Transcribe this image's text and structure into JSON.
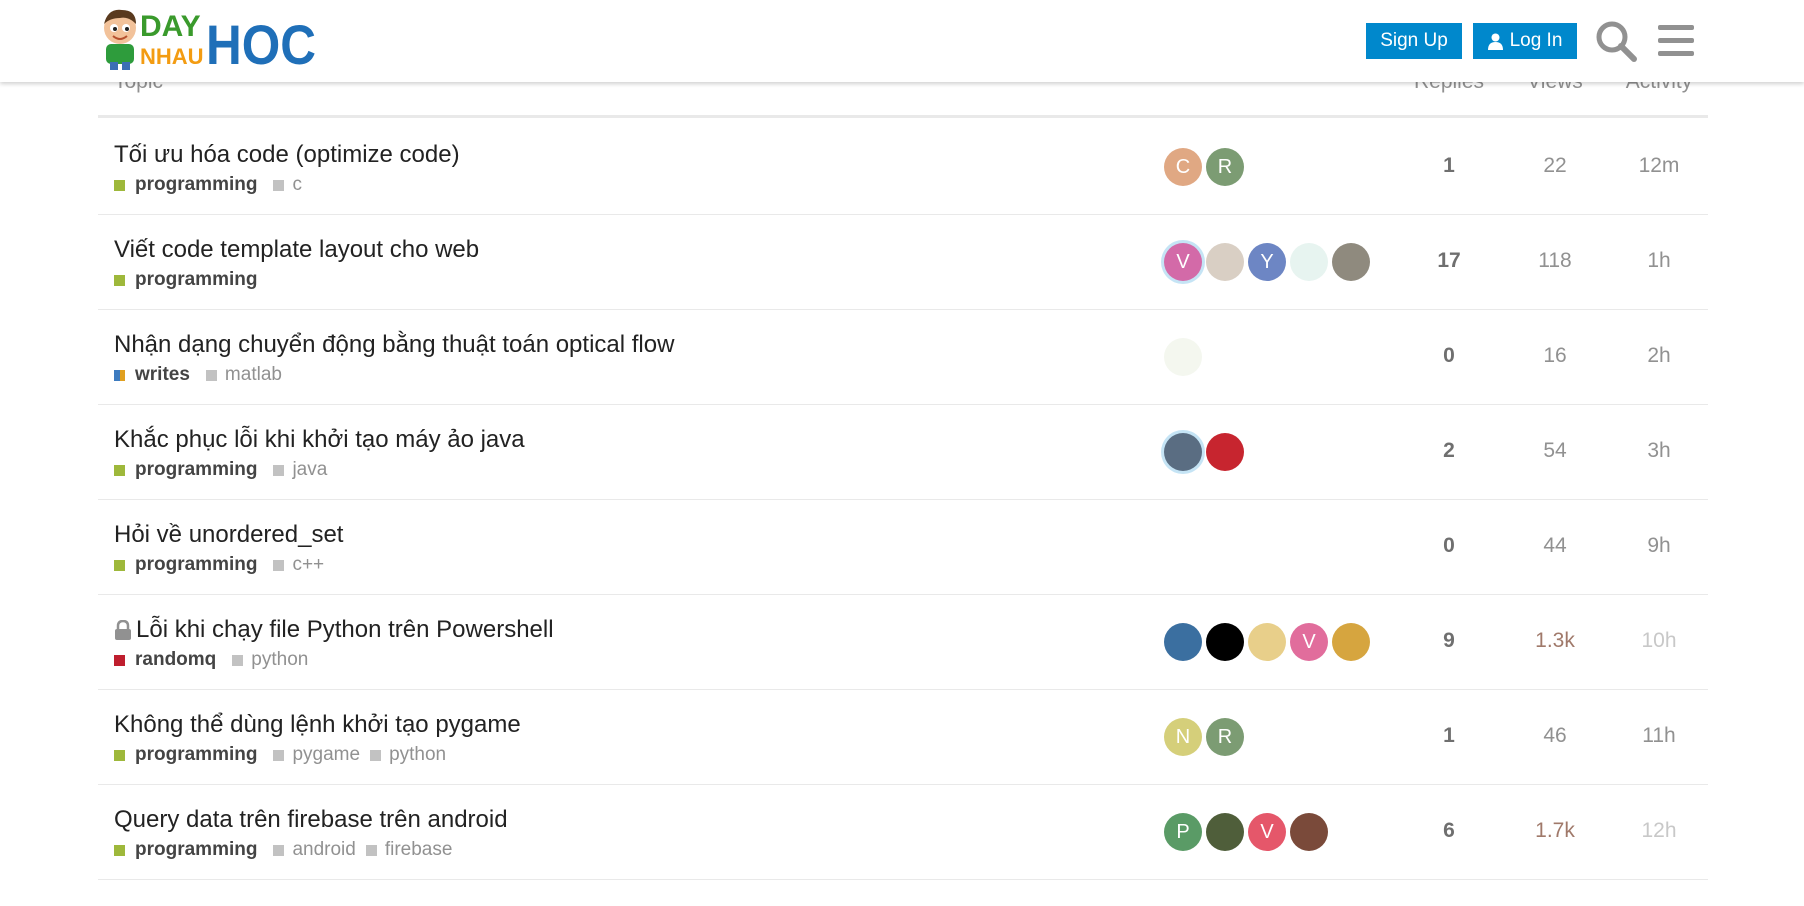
{
  "header": {
    "logo_text": "DAY NHAU HOC",
    "signup_label": "Sign Up",
    "login_label": "Log In",
    "brand_color": "#0088cc"
  },
  "table_head": {
    "topic": "Topic",
    "replies": "Replies",
    "views": "Views",
    "activity": "Activity"
  },
  "topics": [
    {
      "title": "Tối ưu hóa code (optimize code)",
      "category": "programming",
      "category_color": "#9eb83b",
      "tags": [
        "c"
      ],
      "posters": [
        {
          "letter": "C",
          "color": "#e0a883"
        },
        {
          "letter": "R",
          "color": "#7c9c73"
        }
      ],
      "replies": "1",
      "views": "22",
      "activity": "12m"
    },
    {
      "title": "Viết code template layout cho web",
      "category": "programming",
      "category_color": "#9eb83b",
      "tags": [],
      "posters": [
        {
          "letter": "V",
          "color": "#d36aa8"
        },
        {
          "letter": "",
          "color": "#d9cfc4"
        },
        {
          "letter": "Y",
          "color": "#6d86c4"
        },
        {
          "letter": "",
          "color": "#e7f4f0"
        },
        {
          "letter": "",
          "color": "#8f8a7e"
        }
      ],
      "replies": "17",
      "views": "118",
      "activity": "1h"
    },
    {
      "title": "Nhận dạng chuyển động bằng thuật toán optical flow",
      "category": "writes",
      "category_color": "#3d7bbf",
      "category_color2": "#e0a020",
      "tags": [
        "matlab"
      ],
      "posters": [
        {
          "letter": "",
          "color": "#f4f7ef"
        }
      ],
      "replies": "0",
      "views": "16",
      "activity": "2h"
    },
    {
      "title": "Khắc phục lỗi khi khởi tạo máy ảo java",
      "category": "programming",
      "category_color": "#9eb83b",
      "tags": [
        "java"
      ],
      "posters": [
        {
          "letter": "",
          "color": "#5a6d82"
        },
        {
          "letter": "",
          "color": "#c7252f"
        }
      ],
      "replies": "2",
      "views": "54",
      "activity": "3h"
    },
    {
      "title": "Hỏi về unordered_set",
      "category": "programming",
      "category_color": "#9eb83b",
      "tags": [
        "c++"
      ],
      "posters": [],
      "replies": "0",
      "views": "44",
      "activity": "9h"
    },
    {
      "title": "Lỗi khi chạy file Python trên Powershell",
      "closed": true,
      "category": "randomq",
      "category_color": "#bf1e2e",
      "tags": [
        "python"
      ],
      "posters": [
        {
          "letter": "",
          "color": "#3b6fa0"
        },
        {
          "letter": "",
          "color": "#000000"
        },
        {
          "letter": "",
          "color": "#e8cf8a"
        },
        {
          "letter": "V",
          "color": "#e16d9c"
        },
        {
          "letter": "",
          "color": "#d6a53f"
        }
      ],
      "replies": "9",
      "views": "1.3k",
      "activity": "10h"
    },
    {
      "title": "Không thể dùng lệnh khởi tạo pygame",
      "category": "programming",
      "category_color": "#9eb83b",
      "tags": [
        "pygame",
        "python"
      ],
      "posters": [
        {
          "letter": "N",
          "color": "#d5cf7a"
        },
        {
          "letter": "R",
          "color": "#7c9c73"
        }
      ],
      "replies": "1",
      "views": "46",
      "activity": "11h"
    },
    {
      "title": "Query data trên firebase trên android",
      "category": "programming",
      "category_color": "#9eb83b",
      "tags": [
        "android",
        "firebase"
      ],
      "posters": [
        {
          "letter": "P",
          "color": "#5a9b66"
        },
        {
          "letter": "",
          "color": "#4f5e3a"
        },
        {
          "letter": "V",
          "color": "#e5576a"
        },
        {
          "letter": "",
          "color": "#7a4a3a"
        }
      ],
      "replies": "6",
      "views": "1.7k",
      "activity": "12h"
    }
  ]
}
